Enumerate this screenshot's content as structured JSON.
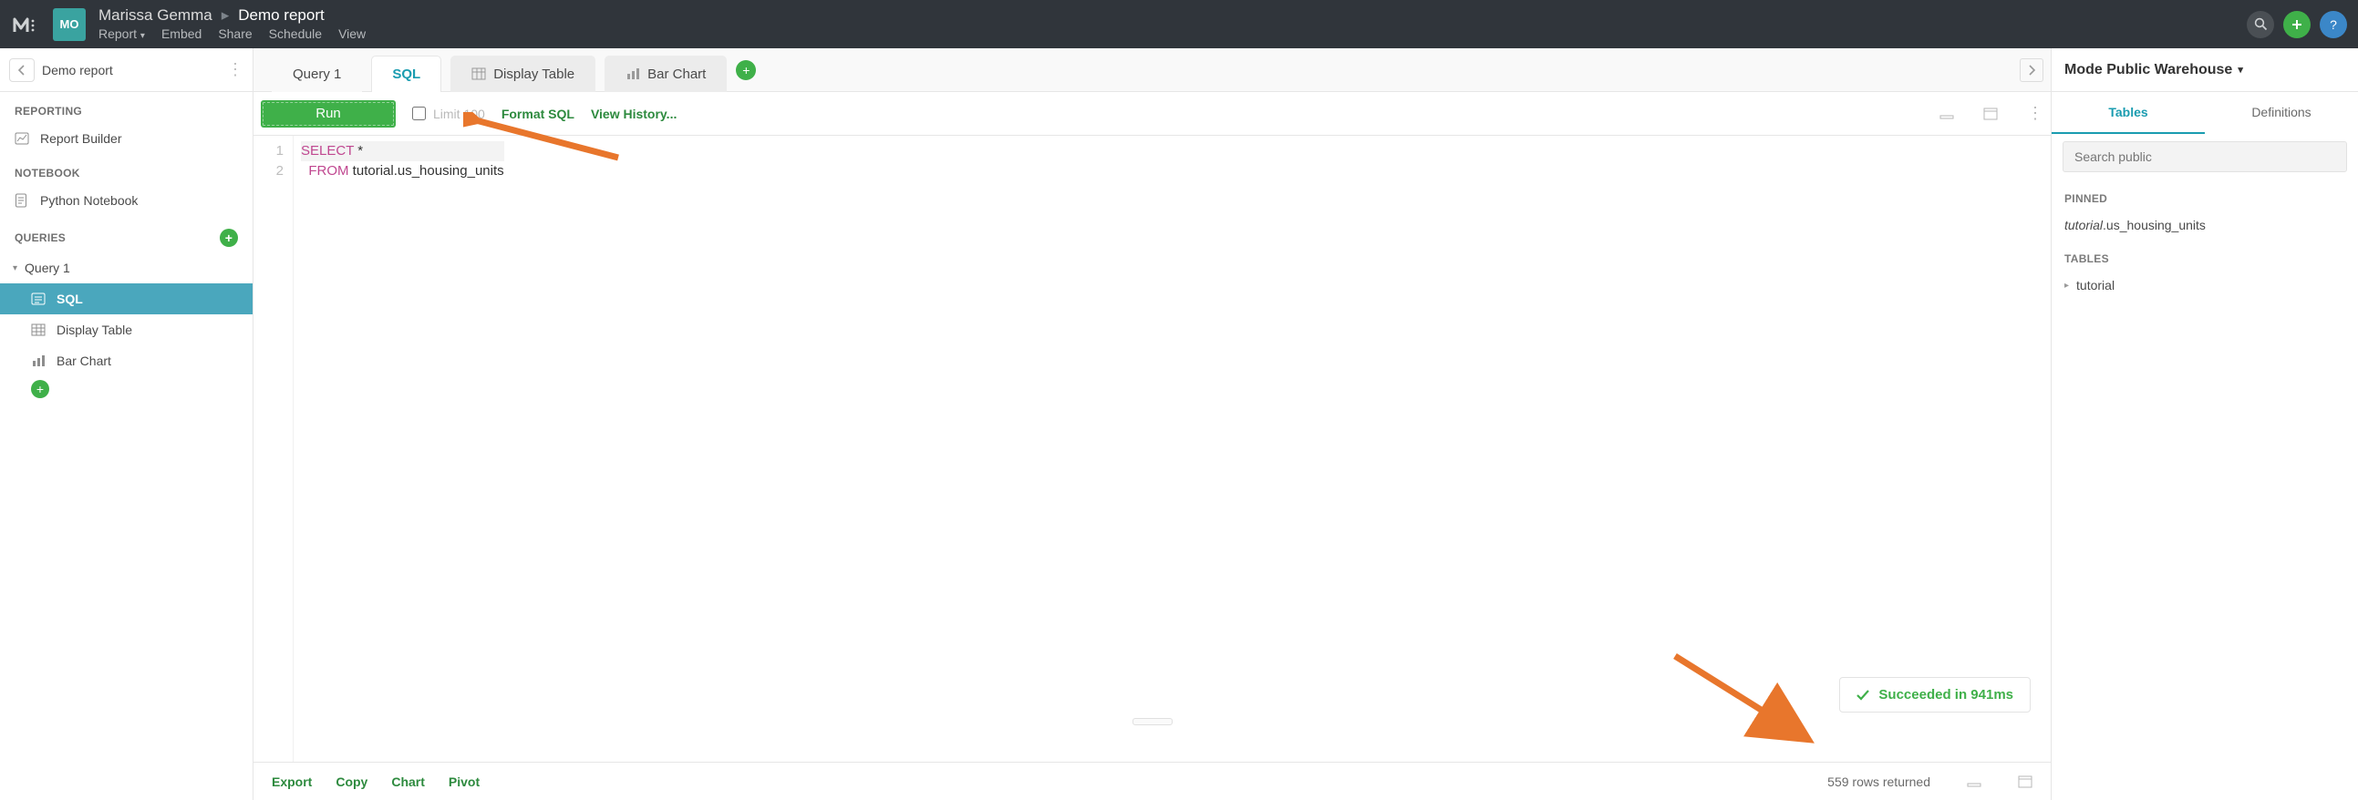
{
  "header": {
    "user_initials": "MO",
    "user_name": "Marissa Gemma",
    "report_name": "Demo report",
    "menu": {
      "report": "Report",
      "embed": "Embed",
      "share": "Share",
      "schedule": "Schedule",
      "view": "View"
    }
  },
  "sidebar": {
    "title": "Demo report",
    "sections": {
      "reporting": "REPORTING",
      "notebook": "NOTEBOOK",
      "queries": "QUERIES"
    },
    "report_builder": "Report Builder",
    "python_notebook": "Python Notebook",
    "query_name": "Query 1",
    "query_children": {
      "sql": "SQL",
      "display_table": "Display Table",
      "bar_chart": "Bar Chart"
    }
  },
  "tabs": {
    "query": "Query 1",
    "sql": "SQL",
    "display_table": "Display Table",
    "bar_chart": "Bar Chart"
  },
  "toolbar": {
    "run": "Run",
    "limit_label": "Limit 100",
    "format_sql": "Format SQL",
    "view_history": "View History..."
  },
  "editor": {
    "line1_kw": "SELECT",
    "line1_rest": " *",
    "line2_kw": "FROM",
    "line2_rest": " tutorial.us_housing_units"
  },
  "status": {
    "text": "Succeeded in 941ms"
  },
  "bottom": {
    "export": "Export",
    "copy": "Copy",
    "chart": "Chart",
    "pivot": "Pivot",
    "rows": "559 rows returned"
  },
  "rpanel": {
    "datasource": "Mode Public Warehouse",
    "tab_tables": "Tables",
    "tab_defs": "Definitions",
    "search_placeholder": "Search public",
    "pinned_label": "PINNED",
    "pinned_item_prefix": "tutorial",
    "pinned_item_suffix": ".us_housing_units",
    "tables_label": "TABLES",
    "tree_item": "tutorial"
  }
}
